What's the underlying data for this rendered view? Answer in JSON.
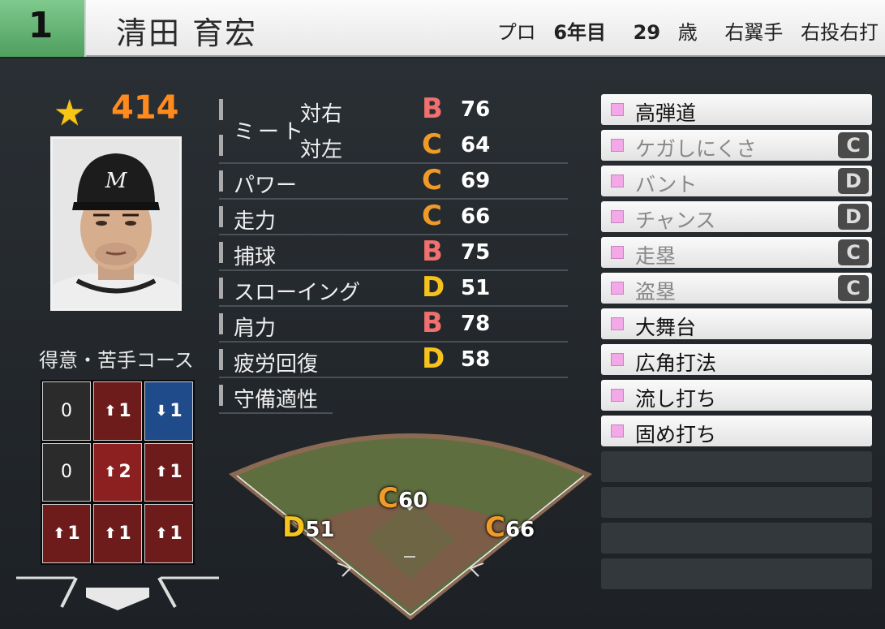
{
  "header": {
    "number": "1",
    "name": "清田 育宏",
    "career_label": "プロ",
    "career_years": "6年目",
    "age": "29",
    "age_unit": "歳",
    "position": "右翼手",
    "handedness": "右投右打"
  },
  "overall": {
    "icon": "star-icon",
    "value": "414"
  },
  "course": {
    "label": "得意・苦手コース",
    "zones": [
      {
        "text": "0",
        "arrow": "",
        "type": "neutral"
      },
      {
        "text": "1",
        "arrow": "up",
        "type": "hot"
      },
      {
        "text": "1",
        "arrow": "down",
        "type": "cold"
      },
      {
        "text": "0",
        "arrow": "",
        "type": "neutral"
      },
      {
        "text": "2",
        "arrow": "up",
        "type": "hot2"
      },
      {
        "text": "1",
        "arrow": "up",
        "type": "hot"
      },
      {
        "text": "1",
        "arrow": "up",
        "type": "hot"
      },
      {
        "text": "1",
        "arrow": "up",
        "type": "hot"
      },
      {
        "text": "1",
        "arrow": "up",
        "type": "hot"
      }
    ]
  },
  "stats": {
    "meet_label": "ミート",
    "vs_right": {
      "name": "対右",
      "grade": "B",
      "value": "76"
    },
    "vs_left": {
      "name": "対左",
      "grade": "C",
      "value": "64"
    },
    "power": {
      "name": "パワー",
      "grade": "C",
      "value": "69"
    },
    "speed": {
      "name": "走力",
      "grade": "C",
      "value": "66"
    },
    "catching": {
      "name": "捕球",
      "grade": "B",
      "value": "75"
    },
    "throwing": {
      "name": "スローイング",
      "grade": "D",
      "value": "51"
    },
    "arm": {
      "name": "肩力",
      "grade": "B",
      "value": "78"
    },
    "recovery": {
      "name": "疲労回復",
      "grade": "D",
      "value": "58"
    },
    "defense_label": "守備適性"
  },
  "defense": {
    "left": {
      "grade": "D",
      "value": "51"
    },
    "center": {
      "grade": "C",
      "value": "60"
    },
    "right": {
      "grade": "C",
      "value": "66"
    }
  },
  "abilities": [
    {
      "name": "高弾道",
      "grade": ""
    },
    {
      "name": "ケガしにくさ",
      "grade": "C"
    },
    {
      "name": "バント",
      "grade": "D"
    },
    {
      "name": "チャンス",
      "grade": "D"
    },
    {
      "name": "走塁",
      "grade": "C"
    },
    {
      "name": "盗塁",
      "grade": "C"
    },
    {
      "name": "大舞台",
      "grade": ""
    },
    {
      "name": "広角打法",
      "grade": ""
    },
    {
      "name": "流し打ち",
      "grade": ""
    },
    {
      "name": "固め打ち",
      "grade": ""
    }
  ],
  "colors": {
    "grade_B": "#f07070",
    "grade_C": "#f09a28",
    "grade_D": "#f6c21c",
    "overall": "#ff8a1e",
    "number_bg": "#5fb06f"
  }
}
